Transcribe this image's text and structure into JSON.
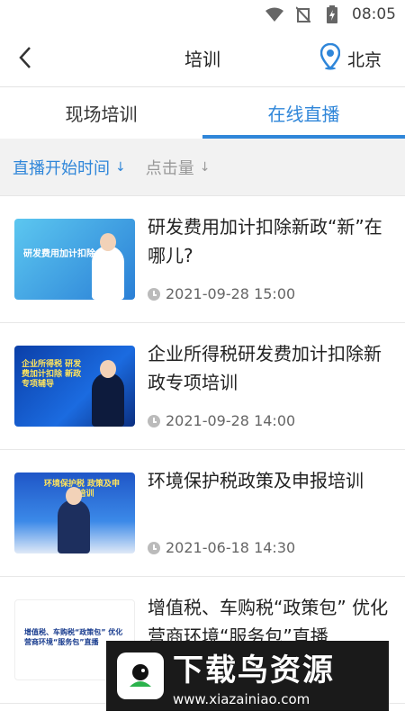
{
  "status_bar": {
    "time": "08:05",
    "icons": [
      "wifi-icon",
      "no-signal-icon",
      "battery-charging-icon"
    ]
  },
  "header": {
    "title": "培训",
    "city": "北京",
    "icons": [
      "back-arrow-icon",
      "location-pin-icon"
    ]
  },
  "tabs": [
    {
      "label": "现场培训",
      "active": false
    },
    {
      "label": "在线直播",
      "active": true
    }
  ],
  "sort": [
    {
      "label": "直播开始时间",
      "arrow": "↓",
      "active": true
    },
    {
      "label": "点击量",
      "arrow": "↓",
      "active": false
    }
  ],
  "items": [
    {
      "title": "研发费用加计扣除新政“新”在哪儿?",
      "date": "2021-09-28 15:00",
      "thumb_text": "研发费用加计扣除"
    },
    {
      "title": "企业所得税研发费加计扣除新政专项培训",
      "date": "2021-09-28 14:00",
      "thumb_text": "企业所得税 研发费加计扣除 新政专项辅导"
    },
    {
      "title": "环境保护税政策及申报培训",
      "date": "2021-06-18 14:30",
      "thumb_text": "环境保护税 政策及申报培训"
    },
    {
      "title": "增值税、车购税“政策包” 优化营商环境“服务包”直播",
      "date": "",
      "thumb_text": "增值税、车购税“政策包” 优化营商环境“服务包”直播"
    }
  ],
  "colors": {
    "accent": "#2f86d9",
    "sort_bg": "#f2f2f2"
  },
  "watermark": {
    "main": "下载鸟资源",
    "url": "www.xiazainiao.com"
  }
}
